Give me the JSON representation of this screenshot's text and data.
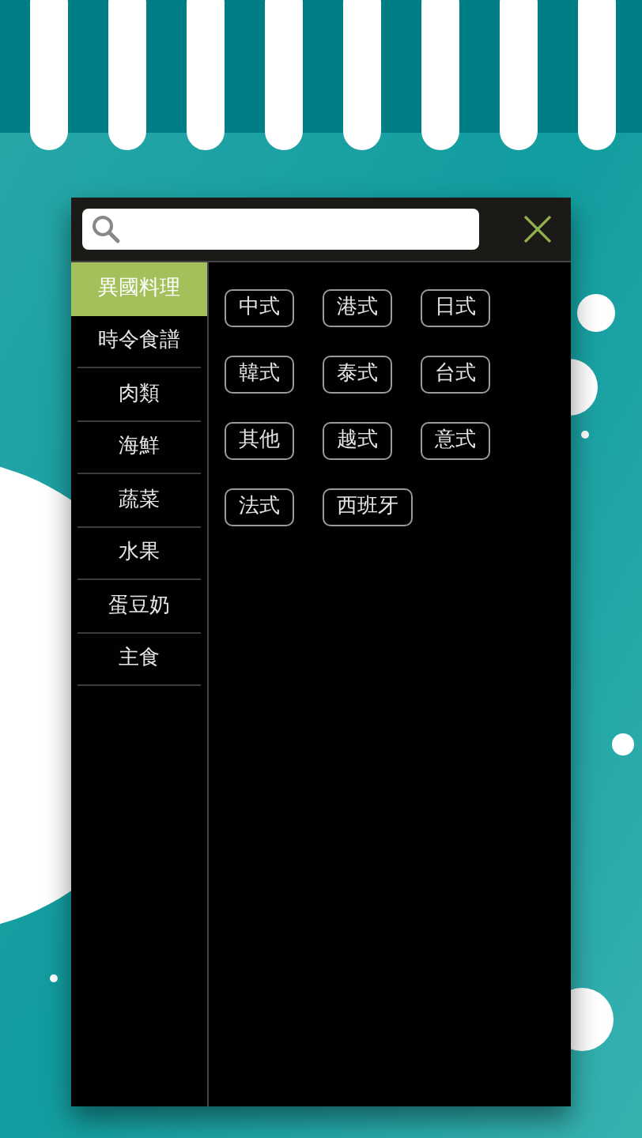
{
  "categories": [
    {
      "label": "異國料理",
      "selected": true
    },
    {
      "label": "時令食譜",
      "selected": false
    },
    {
      "label": "肉類",
      "selected": false
    },
    {
      "label": "海鮮",
      "selected": false
    },
    {
      "label": "蔬菜",
      "selected": false
    },
    {
      "label": "水果",
      "selected": false
    },
    {
      "label": "蛋豆奶",
      "selected": false
    },
    {
      "label": "主食",
      "selected": false
    }
  ],
  "tags": [
    "中式",
    "港式",
    "日式",
    "韓式",
    "泰式",
    "台式",
    "其他",
    "越式",
    "意式",
    "法式",
    "西班牙"
  ]
}
